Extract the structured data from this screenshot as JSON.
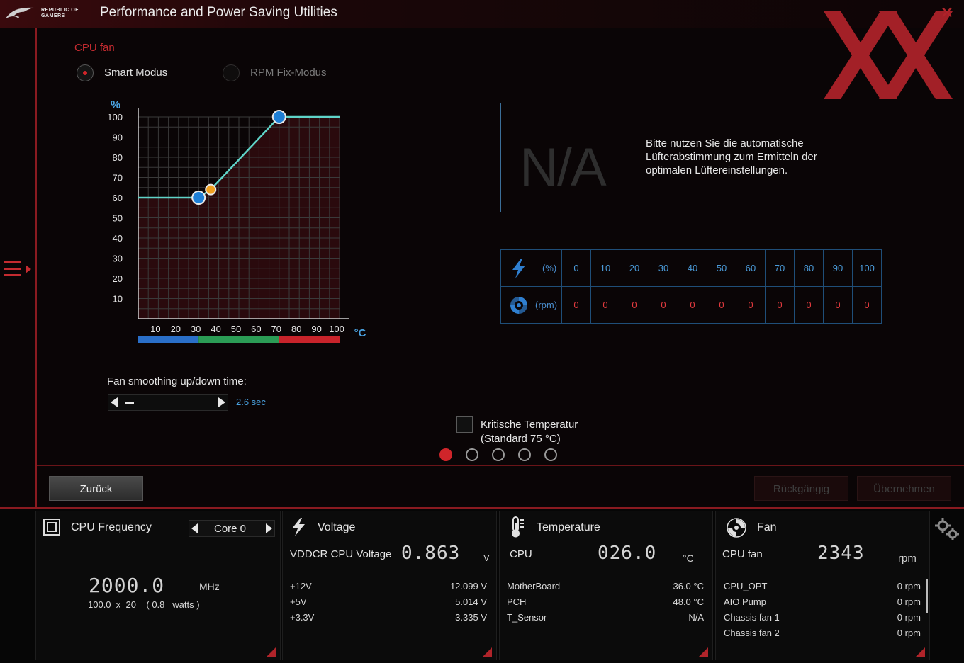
{
  "window": {
    "brand_line1": "REPUBLIC OF",
    "brand_line2": "GAMERS",
    "title": "Performance and Power Saving Utilities",
    "close_glyph": "✕"
  },
  "fan_control": {
    "section_title": "CPU fan",
    "modes": [
      {
        "label": "Smart Modus",
        "selected": true
      },
      {
        "label": "RPM Fix-Modus",
        "selected": false
      }
    ],
    "graph": {
      "y_unit": "%",
      "x_unit": "°C",
      "y_ticks": [
        "100",
        "90",
        "80",
        "70",
        "60",
        "50",
        "40",
        "30",
        "20",
        "10"
      ],
      "x_ticks": [
        "10",
        "20",
        "30",
        "40",
        "50",
        "60",
        "70",
        "80",
        "90",
        "100"
      ],
      "curve_points": [
        {
          "temp": 0,
          "duty": 60
        },
        {
          "temp": 30,
          "duty": 60
        },
        {
          "temp": 36,
          "duty": 64
        },
        {
          "temp": 70,
          "duty": 100
        },
        {
          "temp": 100,
          "duty": 100
        }
      ],
      "handles": [
        {
          "temp": 30,
          "duty": 60,
          "color": "#1e7fd6"
        },
        {
          "temp": 36,
          "duty": 64,
          "color": "#f0a020"
        },
        {
          "temp": 70,
          "duty": 100,
          "color": "#1e7fd6"
        }
      ],
      "zones": [
        {
          "from": 0,
          "to": 30,
          "color": "#2a6fc8"
        },
        {
          "from": 30,
          "to": 70,
          "color": "#2b9c55"
        },
        {
          "from": 70,
          "to": 100,
          "color": "#c8232a"
        }
      ],
      "curve_color": "#5fd4c8"
    },
    "na_display": "N/A",
    "hint": "Bitte nutzen Sie die automatische Lüfterabstimmung zum Ermitteln der optimalen Lüftereinstellungen.",
    "table": {
      "pct_unit": "(%)",
      "rpm_unit": "(rpm)",
      "pct": [
        "0",
        "10",
        "20",
        "30",
        "40",
        "50",
        "60",
        "70",
        "80",
        "90",
        "100"
      ],
      "rpm": [
        "0",
        "0",
        "0",
        "0",
        "0",
        "0",
        "0",
        "0",
        "0",
        "0",
        "0"
      ]
    },
    "smoothing_label": "Fan smoothing up/down time:",
    "smoothing_value": "2.6 sec",
    "critical_label_1": "Kritische Temperatur",
    "critical_label_2": "(Standard 75 °C)",
    "critical_checked": false,
    "pager_pages": 5,
    "pager_active": 0
  },
  "actions": {
    "back": "Zurück",
    "undo": "Rückgängig",
    "apply": "Übernehmen"
  },
  "status": {
    "cpu": {
      "title": "CPU Frequency",
      "core_selected": "Core 0",
      "freq": "2000.0",
      "freq_unit": "MHz",
      "detail": "100.0  x  20    ( 0.8   watts )"
    },
    "voltage": {
      "title": "Voltage",
      "main_label": "VDDCR CPU Voltage",
      "main_value": "0.863",
      "main_unit": "V",
      "rows": [
        {
          "label": "+12V",
          "value": "12.099  V"
        },
        {
          "label": "+5V",
          "value": "5.014  V"
        },
        {
          "label": "+3.3V",
          "value": "3.335  V"
        }
      ]
    },
    "temperature": {
      "title": "Temperature",
      "main_label": "CPU",
      "main_value": "026.0",
      "main_unit": "°C",
      "rows": [
        {
          "label": "MotherBoard",
          "value": "36.0 °C"
        },
        {
          "label": "PCH",
          "value": "48.0 °C"
        },
        {
          "label": "T_Sensor",
          "value": "N/A"
        }
      ]
    },
    "fan": {
      "title": "Fan",
      "main_label": "CPU fan",
      "main_value": "2343",
      "main_unit": "rpm",
      "rows": [
        {
          "label": "CPU_OPT",
          "value": "0  rpm"
        },
        {
          "label": "AIO Pump",
          "value": "0  rpm"
        },
        {
          "label": "Chassis fan 1",
          "value": "0  rpm"
        },
        {
          "label": "Chassis fan 2",
          "value": "0  rpm"
        }
      ]
    }
  },
  "colors": {
    "accent_red": "#c52b30",
    "accent_blue": "#4a9ad8",
    "table_border": "#1f4e78"
  }
}
